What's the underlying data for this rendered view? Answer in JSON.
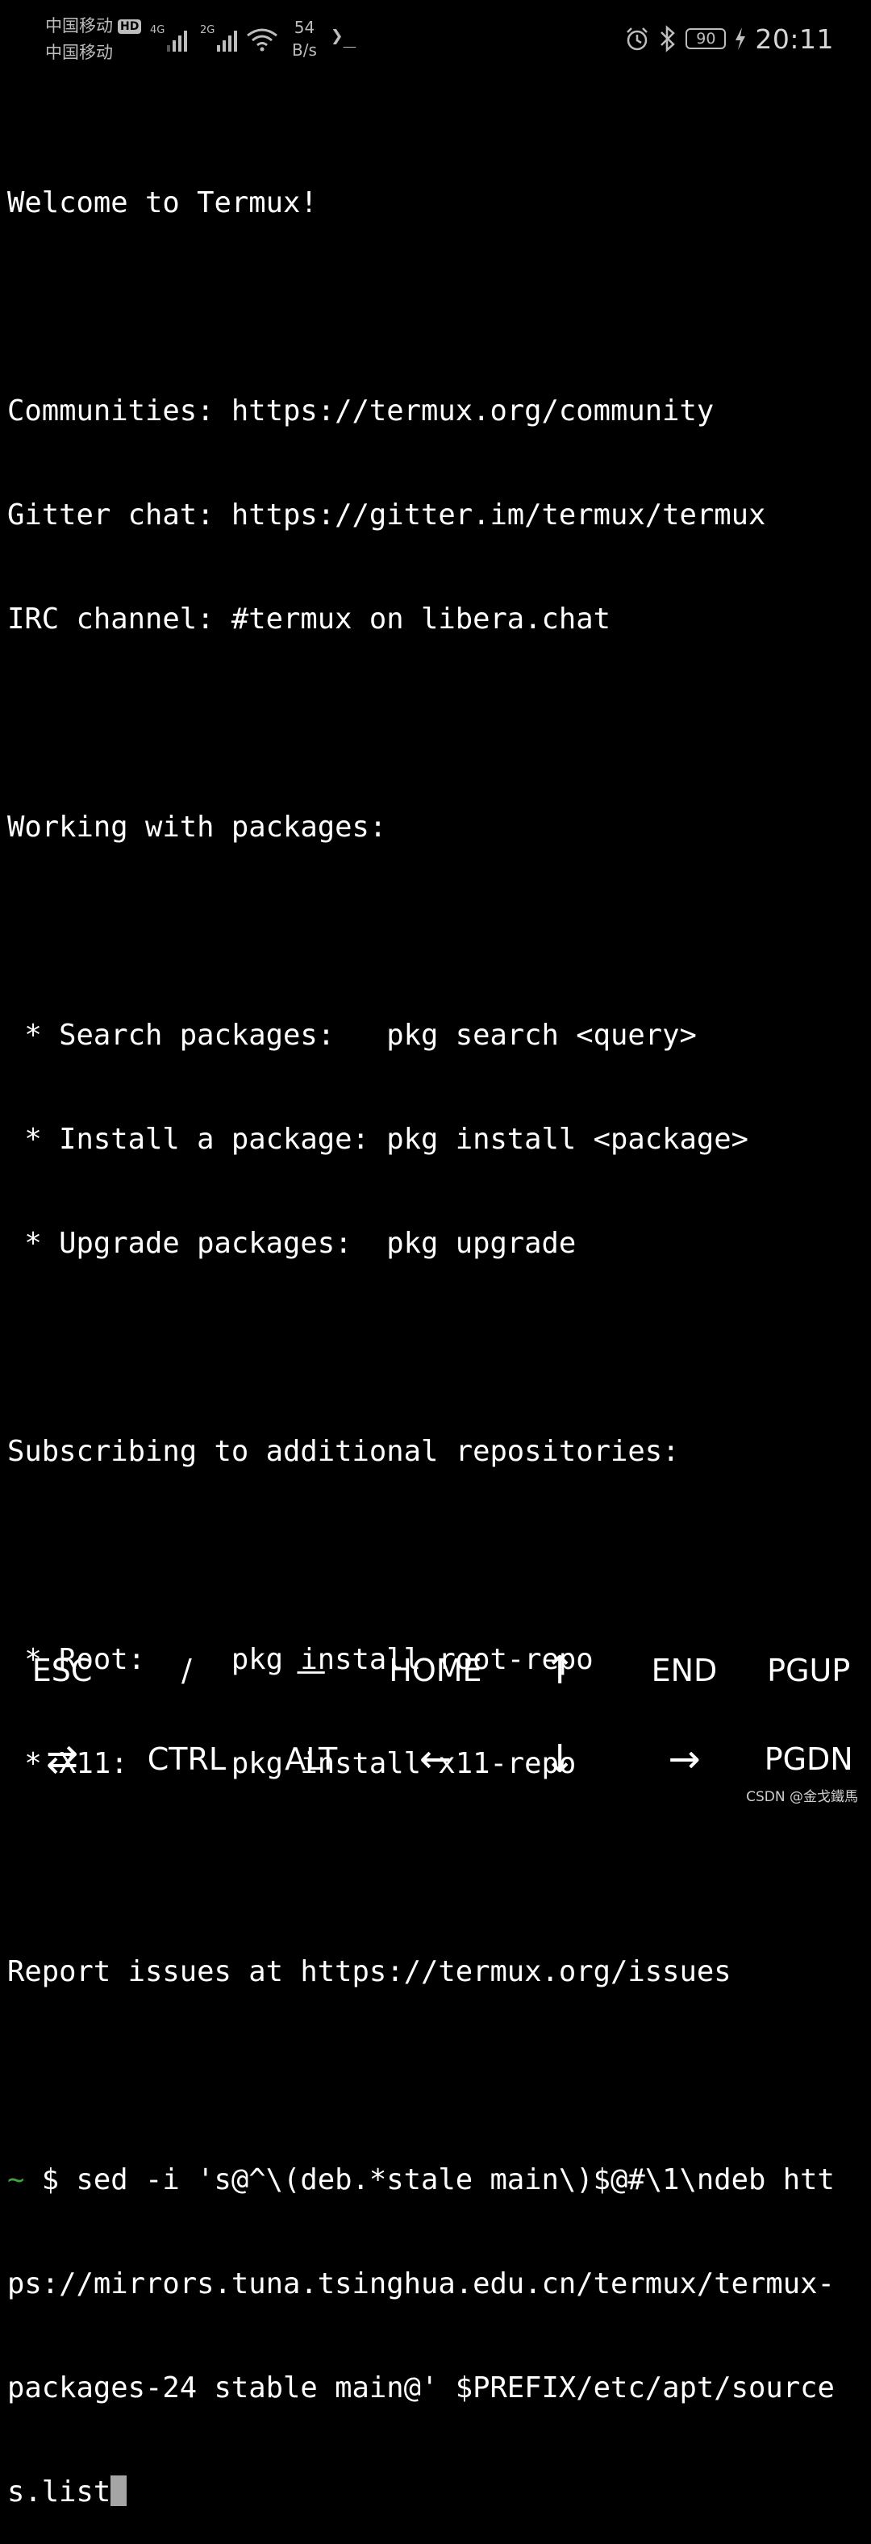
{
  "status_bar": {
    "carrier_primary": "中国移动",
    "hd_badge": "HD",
    "carrier_secondary": "中国移动",
    "network_1": "4G",
    "network_2": "2G",
    "speed_value": "54",
    "speed_unit": "B/s",
    "terminal_glyph": "❯_",
    "battery": "90",
    "time": "20:11"
  },
  "terminal": {
    "lines": [
      "Welcome to Termux!",
      "",
      "Communities: https://termux.org/community",
      "Gitter chat: https://gitter.im/termux/termux",
      "IRC channel: #termux on libera.chat",
      "",
      "Working with packages:",
      "",
      " * Search packages:   pkg search <query>",
      " * Install a package: pkg install <package>",
      " * Upgrade packages:  pkg upgrade",
      "",
      "Subscribing to additional repositories:",
      "",
      " * Root:     pkg install root-repo",
      " * X11:      pkg install x11-repo",
      "",
      "Report issues at https://termux.org/issues",
      ""
    ],
    "prompt_symbol": "~",
    "command_line_1": " $ sed -i 's@^\\(deb.*stale main\\)$@#\\1\\ndeb htt",
    "command_line_2": "ps://mirrors.tuna.tsinghua.edu.cn/termux/termux-",
    "command_line_3": "packages-24 stable main@' $PREFIX/etc/apt/source",
    "command_line_4": "s.list"
  },
  "extra_keys": {
    "row1": [
      {
        "label": "ESC",
        "name": "esc-key"
      },
      {
        "label": "/",
        "name": "slash-key"
      },
      {
        "label": "—",
        "name": "dash-key"
      },
      {
        "label": "HOME",
        "name": "home-key"
      },
      {
        "label": "↑",
        "name": "up-arrow-key"
      },
      {
        "label": "END",
        "name": "end-key"
      },
      {
        "label": "PGUP",
        "name": "pgup-key"
      }
    ],
    "row2": [
      {
        "label": "⇄",
        "name": "tab-key"
      },
      {
        "label": "CTRL",
        "name": "ctrl-key"
      },
      {
        "label": "ALT",
        "name": "alt-key"
      },
      {
        "label": "←",
        "name": "left-arrow-key"
      },
      {
        "label": "↓",
        "name": "down-arrow-key"
      },
      {
        "label": "→",
        "name": "right-arrow-key"
      },
      {
        "label": "PGDN",
        "name": "pgdn-key"
      }
    ]
  },
  "watermark": "CSDN @金戈鐵馬"
}
